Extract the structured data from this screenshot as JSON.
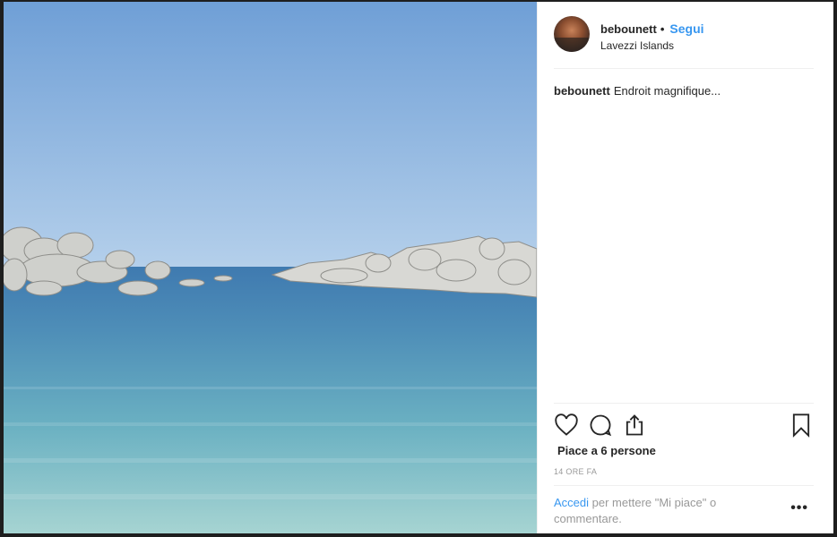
{
  "header": {
    "username": "bebounett",
    "separator": "•",
    "follow_label": "Segui",
    "location": "Lavezzi Islands"
  },
  "caption": {
    "username": "bebounett",
    "text": "Endroit magnifique..."
  },
  "actions": {
    "icons": [
      "heart-icon",
      "comment-icon",
      "share-icon",
      "bookmark-icon"
    ]
  },
  "likes_text": "Piace a 6 persone",
  "timestamp": "14 ORE FA",
  "footer": {
    "login_link": "Accedi",
    "login_rest": "per mettere \"Mi piace\" o commentare.",
    "more_label": "•••"
  },
  "colors": {
    "accent": "#3897f0",
    "text": "#262626",
    "muted": "#999999",
    "window_frame": "#1e1e1e"
  }
}
